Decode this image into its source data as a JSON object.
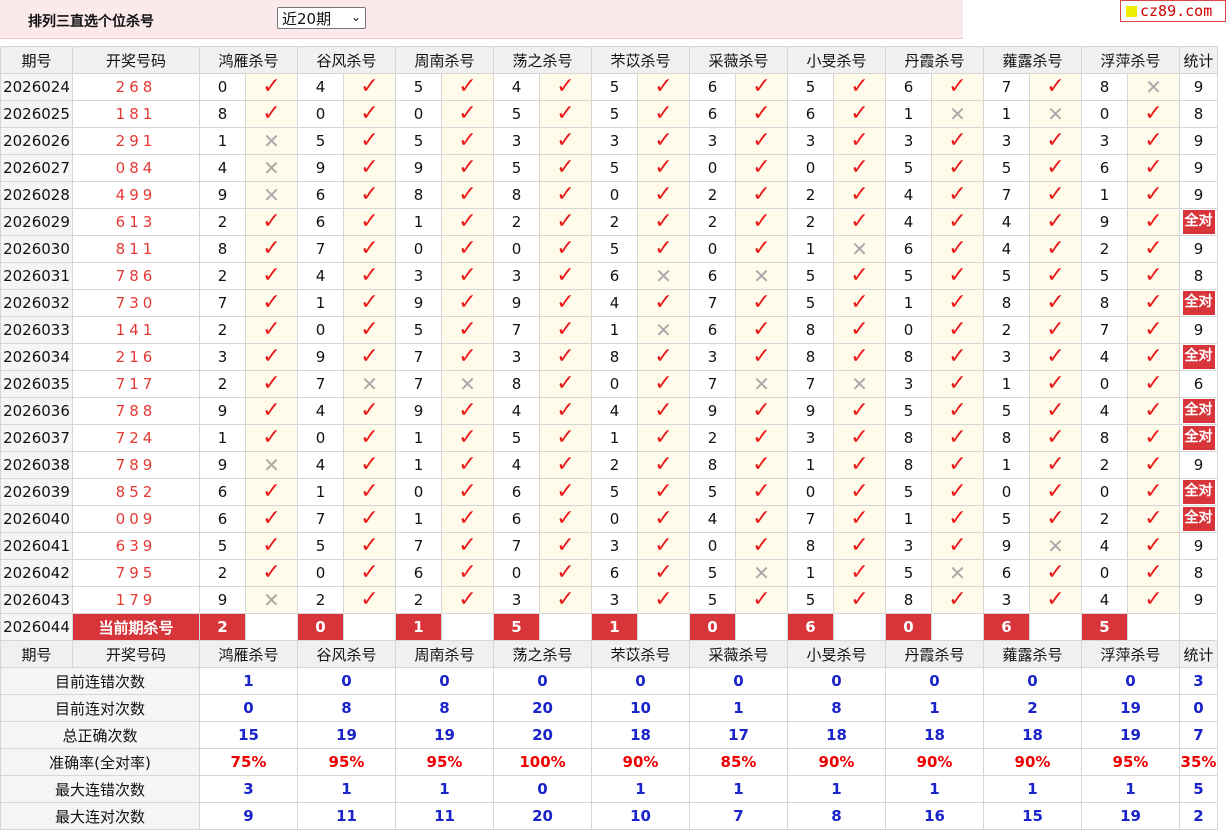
{
  "header": {
    "title": "排列三直选个位杀号",
    "period_select": "近20期",
    "logo_text": "cz89.com"
  },
  "columns": {
    "qihao": "期号",
    "kaijiang": "开奖号码",
    "experts": [
      "鸿雁杀号",
      "谷风杀号",
      "周南杀号",
      "荡之杀号",
      "芣苡杀号",
      "采薇杀号",
      "小旻杀号",
      "丹霞杀号",
      "蕹露杀号",
      "浮萍杀号"
    ],
    "stat": "统计"
  },
  "all_right_label": "全对",
  "rows": [
    {
      "q": "2026024",
      "n": "268",
      "k": [
        [
          0,
          1
        ],
        [
          4,
          1
        ],
        [
          5,
          1
        ],
        [
          4,
          1
        ],
        [
          5,
          1
        ],
        [
          6,
          1
        ],
        [
          5,
          1
        ],
        [
          6,
          1
        ],
        [
          7,
          1
        ],
        [
          8,
          0
        ]
      ],
      "s": "9"
    },
    {
      "q": "2026025",
      "n": "181",
      "k": [
        [
          8,
          1
        ],
        [
          0,
          1
        ],
        [
          0,
          1
        ],
        [
          5,
          1
        ],
        [
          5,
          1
        ],
        [
          6,
          1
        ],
        [
          6,
          1
        ],
        [
          1,
          0
        ],
        [
          1,
          0
        ],
        [
          0,
          1
        ]
      ],
      "s": "8"
    },
    {
      "q": "2026026",
      "n": "291",
      "k": [
        [
          1,
          0
        ],
        [
          5,
          1
        ],
        [
          5,
          1
        ],
        [
          3,
          1
        ],
        [
          3,
          1
        ],
        [
          3,
          1
        ],
        [
          3,
          1
        ],
        [
          3,
          1
        ],
        [
          3,
          1
        ],
        [
          3,
          1
        ]
      ],
      "s": "9"
    },
    {
      "q": "2026027",
      "n": "084",
      "k": [
        [
          4,
          0
        ],
        [
          9,
          1
        ],
        [
          9,
          1
        ],
        [
          5,
          1
        ],
        [
          5,
          1
        ],
        [
          0,
          1
        ],
        [
          0,
          1
        ],
        [
          5,
          1
        ],
        [
          5,
          1
        ],
        [
          6,
          1
        ]
      ],
      "s": "9"
    },
    {
      "q": "2026028",
      "n": "499",
      "k": [
        [
          9,
          0
        ],
        [
          6,
          1
        ],
        [
          8,
          1
        ],
        [
          8,
          1
        ],
        [
          0,
          1
        ],
        [
          2,
          1
        ],
        [
          2,
          1
        ],
        [
          4,
          1
        ],
        [
          7,
          1
        ],
        [
          1,
          1
        ]
      ],
      "s": "9"
    },
    {
      "q": "2026029",
      "n": "613",
      "k": [
        [
          2,
          1
        ],
        [
          6,
          1
        ],
        [
          1,
          1
        ],
        [
          2,
          1
        ],
        [
          2,
          1
        ],
        [
          2,
          1
        ],
        [
          2,
          1
        ],
        [
          4,
          1
        ],
        [
          4,
          1
        ],
        [
          9,
          1
        ]
      ],
      "s": "全对"
    },
    {
      "q": "2026030",
      "n": "811",
      "k": [
        [
          8,
          1
        ],
        [
          7,
          1
        ],
        [
          0,
          1
        ],
        [
          0,
          1
        ],
        [
          5,
          1
        ],
        [
          0,
          1
        ],
        [
          1,
          0
        ],
        [
          6,
          1
        ],
        [
          4,
          1
        ],
        [
          2,
          1
        ]
      ],
      "s": "9"
    },
    {
      "q": "2026031",
      "n": "786",
      "k": [
        [
          2,
          1
        ],
        [
          4,
          1
        ],
        [
          3,
          1
        ],
        [
          3,
          1
        ],
        [
          6,
          0
        ],
        [
          6,
          0
        ],
        [
          5,
          1
        ],
        [
          5,
          1
        ],
        [
          5,
          1
        ],
        [
          5,
          1
        ]
      ],
      "s": "8"
    },
    {
      "q": "2026032",
      "n": "730",
      "k": [
        [
          7,
          1
        ],
        [
          1,
          1
        ],
        [
          9,
          1
        ],
        [
          9,
          1
        ],
        [
          4,
          1
        ],
        [
          7,
          1
        ],
        [
          5,
          1
        ],
        [
          1,
          1
        ],
        [
          8,
          1
        ],
        [
          8,
          1
        ]
      ],
      "s": "全对"
    },
    {
      "q": "2026033",
      "n": "141",
      "k": [
        [
          2,
          1
        ],
        [
          0,
          1
        ],
        [
          5,
          1
        ],
        [
          7,
          1
        ],
        [
          1,
          0
        ],
        [
          6,
          1
        ],
        [
          8,
          1
        ],
        [
          0,
          1
        ],
        [
          2,
          1
        ],
        [
          7,
          1
        ]
      ],
      "s": "9"
    },
    {
      "q": "2026034",
      "n": "216",
      "k": [
        [
          3,
          1
        ],
        [
          9,
          1
        ],
        [
          7,
          1
        ],
        [
          3,
          1
        ],
        [
          8,
          1
        ],
        [
          3,
          1
        ],
        [
          8,
          1
        ],
        [
          8,
          1
        ],
        [
          3,
          1
        ],
        [
          4,
          1
        ]
      ],
      "s": "全对"
    },
    {
      "q": "2026035",
      "n": "717",
      "k": [
        [
          2,
          1
        ],
        [
          7,
          0
        ],
        [
          7,
          0
        ],
        [
          8,
          1
        ],
        [
          0,
          1
        ],
        [
          7,
          0
        ],
        [
          7,
          0
        ],
        [
          3,
          1
        ],
        [
          1,
          1
        ],
        [
          0,
          1
        ]
      ],
      "s": "6"
    },
    {
      "q": "2026036",
      "n": "788",
      "k": [
        [
          9,
          1
        ],
        [
          4,
          1
        ],
        [
          9,
          1
        ],
        [
          4,
          1
        ],
        [
          4,
          1
        ],
        [
          9,
          1
        ],
        [
          9,
          1
        ],
        [
          5,
          1
        ],
        [
          5,
          1
        ],
        [
          4,
          1
        ]
      ],
      "s": "全对"
    },
    {
      "q": "2026037",
      "n": "724",
      "k": [
        [
          1,
          1
        ],
        [
          0,
          1
        ],
        [
          1,
          1
        ],
        [
          5,
          1
        ],
        [
          1,
          1
        ],
        [
          2,
          1
        ],
        [
          3,
          1
        ],
        [
          8,
          1
        ],
        [
          8,
          1
        ],
        [
          8,
          1
        ]
      ],
      "s": "全对"
    },
    {
      "q": "2026038",
      "n": "789",
      "k": [
        [
          9,
          0
        ],
        [
          4,
          1
        ],
        [
          1,
          1
        ],
        [
          4,
          1
        ],
        [
          2,
          1
        ],
        [
          8,
          1
        ],
        [
          1,
          1
        ],
        [
          8,
          1
        ],
        [
          1,
          1
        ],
        [
          2,
          1
        ]
      ],
      "s": "9"
    },
    {
      "q": "2026039",
      "n": "852",
      "k": [
        [
          6,
          1
        ],
        [
          1,
          1
        ],
        [
          0,
          1
        ],
        [
          6,
          1
        ],
        [
          5,
          1
        ],
        [
          5,
          1
        ],
        [
          0,
          1
        ],
        [
          5,
          1
        ],
        [
          0,
          1
        ],
        [
          0,
          1
        ]
      ],
      "s": "全对"
    },
    {
      "q": "2026040",
      "n": "009",
      "k": [
        [
          6,
          1
        ],
        [
          7,
          1
        ],
        [
          1,
          1
        ],
        [
          6,
          1
        ],
        [
          0,
          1
        ],
        [
          4,
          1
        ],
        [
          7,
          1
        ],
        [
          1,
          1
        ],
        [
          5,
          1
        ],
        [
          2,
          1
        ]
      ],
      "s": "全对"
    },
    {
      "q": "2026041",
      "n": "639",
      "k": [
        [
          5,
          1
        ],
        [
          5,
          1
        ],
        [
          7,
          1
        ],
        [
          7,
          1
        ],
        [
          3,
          1
        ],
        [
          0,
          1
        ],
        [
          8,
          1
        ],
        [
          3,
          1
        ],
        [
          9,
          0
        ],
        [
          4,
          1
        ]
      ],
      "s": "9"
    },
    {
      "q": "2026042",
      "n": "795",
      "k": [
        [
          2,
          1
        ],
        [
          0,
          1
        ],
        [
          6,
          1
        ],
        [
          0,
          1
        ],
        [
          6,
          1
        ],
        [
          5,
          0
        ],
        [
          1,
          1
        ],
        [
          5,
          0
        ],
        [
          6,
          1
        ],
        [
          0,
          1
        ]
      ],
      "s": "8"
    },
    {
      "q": "2026043",
      "n": "179",
      "k": [
        [
          9,
          0
        ],
        [
          2,
          1
        ],
        [
          2,
          1
        ],
        [
          3,
          1
        ],
        [
          3,
          1
        ],
        [
          5,
          1
        ],
        [
          5,
          1
        ],
        [
          8,
          1
        ],
        [
          3,
          1
        ],
        [
          4,
          1
        ]
      ],
      "s": "9"
    }
  ],
  "current": {
    "q": "2026044",
    "label": "当前期杀号",
    "kills": [
      "2",
      "0",
      "1",
      "5",
      "1",
      "0",
      "6",
      "0",
      "6",
      "5"
    ]
  },
  "stats": [
    {
      "label": "目前连错次数",
      "v": [
        "1",
        "0",
        "0",
        "0",
        "0",
        "0",
        "0",
        "0",
        "0",
        "0"
      ],
      "s": "3"
    },
    {
      "label": "目前连对次数",
      "v": [
        "0",
        "8",
        "8",
        "20",
        "10",
        "1",
        "8",
        "1",
        "2",
        "19"
      ],
      "s": "0"
    },
    {
      "label": "总正确次数",
      "v": [
        "15",
        "19",
        "19",
        "20",
        "18",
        "17",
        "18",
        "18",
        "18",
        "19"
      ],
      "s": "7"
    },
    {
      "label": "准确率(全对率)",
      "v": [
        "75%",
        "95%",
        "95%",
        "100%",
        "90%",
        "85%",
        "90%",
        "90%",
        "90%",
        "95%"
      ],
      "s": "35%",
      "red": true
    },
    {
      "label": "最大连错次数",
      "v": [
        "3",
        "1",
        "1",
        "0",
        "1",
        "1",
        "1",
        "1",
        "1",
        "1"
      ],
      "s": "5"
    },
    {
      "label": "最大连对次数",
      "v": [
        "9",
        "11",
        "11",
        "20",
        "10",
        "7",
        "8",
        "16",
        "15",
        "19"
      ],
      "s": "2"
    }
  ]
}
